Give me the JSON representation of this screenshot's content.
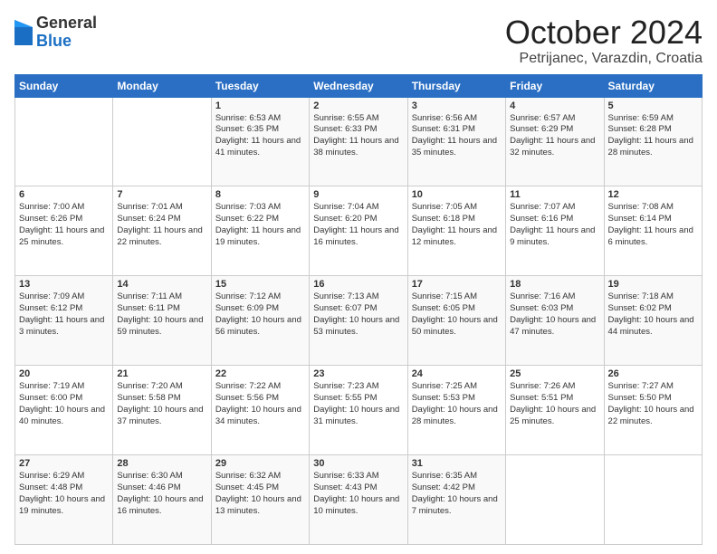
{
  "logo": {
    "general": "General",
    "blue": "Blue"
  },
  "header": {
    "month": "October 2024",
    "location": "Petrijanec, Varazdin, Croatia"
  },
  "weekdays": [
    "Sunday",
    "Monday",
    "Tuesday",
    "Wednesday",
    "Thursday",
    "Friday",
    "Saturday"
  ],
  "weeks": [
    [
      {
        "day": "",
        "sunrise": "",
        "sunset": "",
        "daylight": ""
      },
      {
        "day": "",
        "sunrise": "",
        "sunset": "",
        "daylight": ""
      },
      {
        "day": "1",
        "sunrise": "Sunrise: 6:53 AM",
        "sunset": "Sunset: 6:35 PM",
        "daylight": "Daylight: 11 hours and 41 minutes."
      },
      {
        "day": "2",
        "sunrise": "Sunrise: 6:55 AM",
        "sunset": "Sunset: 6:33 PM",
        "daylight": "Daylight: 11 hours and 38 minutes."
      },
      {
        "day": "3",
        "sunrise": "Sunrise: 6:56 AM",
        "sunset": "Sunset: 6:31 PM",
        "daylight": "Daylight: 11 hours and 35 minutes."
      },
      {
        "day": "4",
        "sunrise": "Sunrise: 6:57 AM",
        "sunset": "Sunset: 6:29 PM",
        "daylight": "Daylight: 11 hours and 32 minutes."
      },
      {
        "day": "5",
        "sunrise": "Sunrise: 6:59 AM",
        "sunset": "Sunset: 6:28 PM",
        "daylight": "Daylight: 11 hours and 28 minutes."
      }
    ],
    [
      {
        "day": "6",
        "sunrise": "Sunrise: 7:00 AM",
        "sunset": "Sunset: 6:26 PM",
        "daylight": "Daylight: 11 hours and 25 minutes."
      },
      {
        "day": "7",
        "sunrise": "Sunrise: 7:01 AM",
        "sunset": "Sunset: 6:24 PM",
        "daylight": "Daylight: 11 hours and 22 minutes."
      },
      {
        "day": "8",
        "sunrise": "Sunrise: 7:03 AM",
        "sunset": "Sunset: 6:22 PM",
        "daylight": "Daylight: 11 hours and 19 minutes."
      },
      {
        "day": "9",
        "sunrise": "Sunrise: 7:04 AM",
        "sunset": "Sunset: 6:20 PM",
        "daylight": "Daylight: 11 hours and 16 minutes."
      },
      {
        "day": "10",
        "sunrise": "Sunrise: 7:05 AM",
        "sunset": "Sunset: 6:18 PM",
        "daylight": "Daylight: 11 hours and 12 minutes."
      },
      {
        "day": "11",
        "sunrise": "Sunrise: 7:07 AM",
        "sunset": "Sunset: 6:16 PM",
        "daylight": "Daylight: 11 hours and 9 minutes."
      },
      {
        "day": "12",
        "sunrise": "Sunrise: 7:08 AM",
        "sunset": "Sunset: 6:14 PM",
        "daylight": "Daylight: 11 hours and 6 minutes."
      }
    ],
    [
      {
        "day": "13",
        "sunrise": "Sunrise: 7:09 AM",
        "sunset": "Sunset: 6:12 PM",
        "daylight": "Daylight: 11 hours and 3 minutes."
      },
      {
        "day": "14",
        "sunrise": "Sunrise: 7:11 AM",
        "sunset": "Sunset: 6:11 PM",
        "daylight": "Daylight: 10 hours and 59 minutes."
      },
      {
        "day": "15",
        "sunrise": "Sunrise: 7:12 AM",
        "sunset": "Sunset: 6:09 PM",
        "daylight": "Daylight: 10 hours and 56 minutes."
      },
      {
        "day": "16",
        "sunrise": "Sunrise: 7:13 AM",
        "sunset": "Sunset: 6:07 PM",
        "daylight": "Daylight: 10 hours and 53 minutes."
      },
      {
        "day": "17",
        "sunrise": "Sunrise: 7:15 AM",
        "sunset": "Sunset: 6:05 PM",
        "daylight": "Daylight: 10 hours and 50 minutes."
      },
      {
        "day": "18",
        "sunrise": "Sunrise: 7:16 AM",
        "sunset": "Sunset: 6:03 PM",
        "daylight": "Daylight: 10 hours and 47 minutes."
      },
      {
        "day": "19",
        "sunrise": "Sunrise: 7:18 AM",
        "sunset": "Sunset: 6:02 PM",
        "daylight": "Daylight: 10 hours and 44 minutes."
      }
    ],
    [
      {
        "day": "20",
        "sunrise": "Sunrise: 7:19 AM",
        "sunset": "Sunset: 6:00 PM",
        "daylight": "Daylight: 10 hours and 40 minutes."
      },
      {
        "day": "21",
        "sunrise": "Sunrise: 7:20 AM",
        "sunset": "Sunset: 5:58 PM",
        "daylight": "Daylight: 10 hours and 37 minutes."
      },
      {
        "day": "22",
        "sunrise": "Sunrise: 7:22 AM",
        "sunset": "Sunset: 5:56 PM",
        "daylight": "Daylight: 10 hours and 34 minutes."
      },
      {
        "day": "23",
        "sunrise": "Sunrise: 7:23 AM",
        "sunset": "Sunset: 5:55 PM",
        "daylight": "Daylight: 10 hours and 31 minutes."
      },
      {
        "day": "24",
        "sunrise": "Sunrise: 7:25 AM",
        "sunset": "Sunset: 5:53 PM",
        "daylight": "Daylight: 10 hours and 28 minutes."
      },
      {
        "day": "25",
        "sunrise": "Sunrise: 7:26 AM",
        "sunset": "Sunset: 5:51 PM",
        "daylight": "Daylight: 10 hours and 25 minutes."
      },
      {
        "day": "26",
        "sunrise": "Sunrise: 7:27 AM",
        "sunset": "Sunset: 5:50 PM",
        "daylight": "Daylight: 10 hours and 22 minutes."
      }
    ],
    [
      {
        "day": "27",
        "sunrise": "Sunrise: 6:29 AM",
        "sunset": "Sunset: 4:48 PM",
        "daylight": "Daylight: 10 hours and 19 minutes."
      },
      {
        "day": "28",
        "sunrise": "Sunrise: 6:30 AM",
        "sunset": "Sunset: 4:46 PM",
        "daylight": "Daylight: 10 hours and 16 minutes."
      },
      {
        "day": "29",
        "sunrise": "Sunrise: 6:32 AM",
        "sunset": "Sunset: 4:45 PM",
        "daylight": "Daylight: 10 hours and 13 minutes."
      },
      {
        "day": "30",
        "sunrise": "Sunrise: 6:33 AM",
        "sunset": "Sunset: 4:43 PM",
        "daylight": "Daylight: 10 hours and 10 minutes."
      },
      {
        "day": "31",
        "sunrise": "Sunrise: 6:35 AM",
        "sunset": "Sunset: 4:42 PM",
        "daylight": "Daylight: 10 hours and 7 minutes."
      },
      {
        "day": "",
        "sunrise": "",
        "sunset": "",
        "daylight": ""
      },
      {
        "day": "",
        "sunrise": "",
        "sunset": "",
        "daylight": ""
      }
    ]
  ]
}
